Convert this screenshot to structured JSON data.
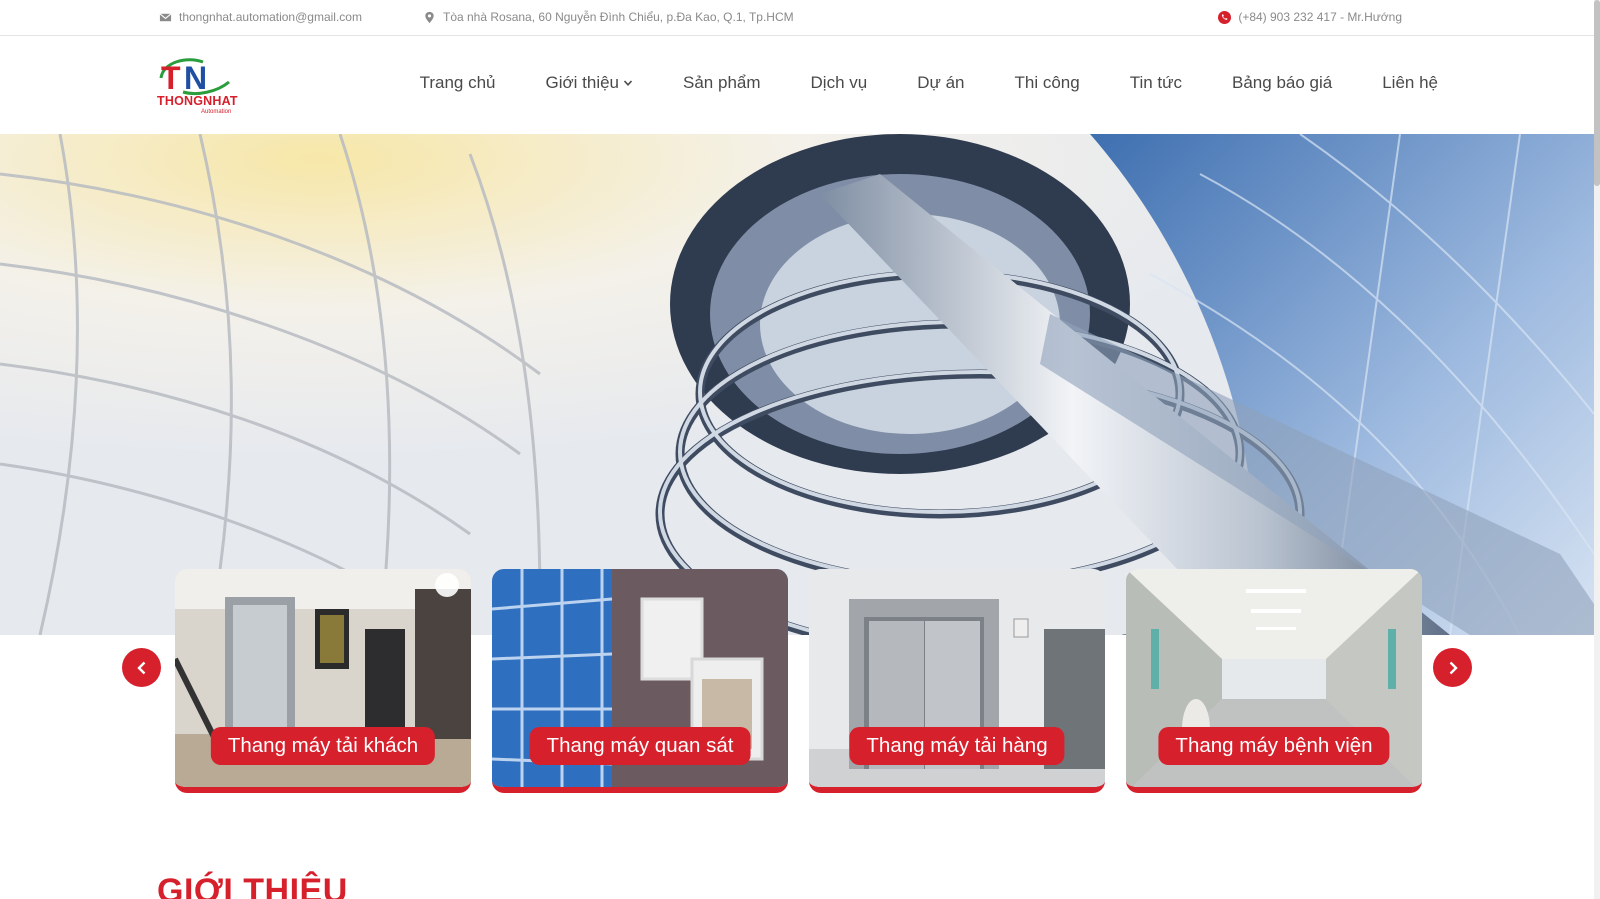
{
  "topbar": {
    "email": "thongnhat.automation@gmail.com",
    "address": "Tòa nhà Rosana, 60 Nguyễn Đình Chiểu, p.Đa Kao, Q.1, Tp.HCM",
    "phone": "(+84) 903 232 417 - Mr.Hướng",
    "icons": [
      "mail-icon",
      "location-pin-icon",
      "phone-icon"
    ]
  },
  "logo": {
    "mark": "TN",
    "name": "THONGNHAT",
    "tagline": "Automation"
  },
  "nav": {
    "items": [
      {
        "label": "Trang chủ"
      },
      {
        "label": "Giới thiệu",
        "has_dropdown": true
      },
      {
        "label": "Sản phẩm"
      },
      {
        "label": "Dịch vụ"
      },
      {
        "label": "Dự án"
      },
      {
        "label": "Thi công"
      },
      {
        "label": "Tin tức"
      },
      {
        "label": "Bảng báo giá"
      },
      {
        "label": "Liên hệ"
      }
    ]
  },
  "carousel": {
    "cards": [
      {
        "label": "Thang máy tải khách"
      },
      {
        "label": "Thang máy quan sát"
      },
      {
        "label": "Thang máy tải hàng"
      },
      {
        "label": "Thang máy bệnh viện"
      }
    ],
    "prev_icon": "chevron-left-icon",
    "next_icon": "chevron-right-icon"
  },
  "intro": {
    "title": "GIỚI THIỆU"
  },
  "colors": {
    "accent": "#d6202c",
    "nav_text": "#4a4a4a",
    "topbar_text": "#8a8a8a",
    "logo_green": "#2a9d3c",
    "logo_blue": "#1f4fa3"
  }
}
